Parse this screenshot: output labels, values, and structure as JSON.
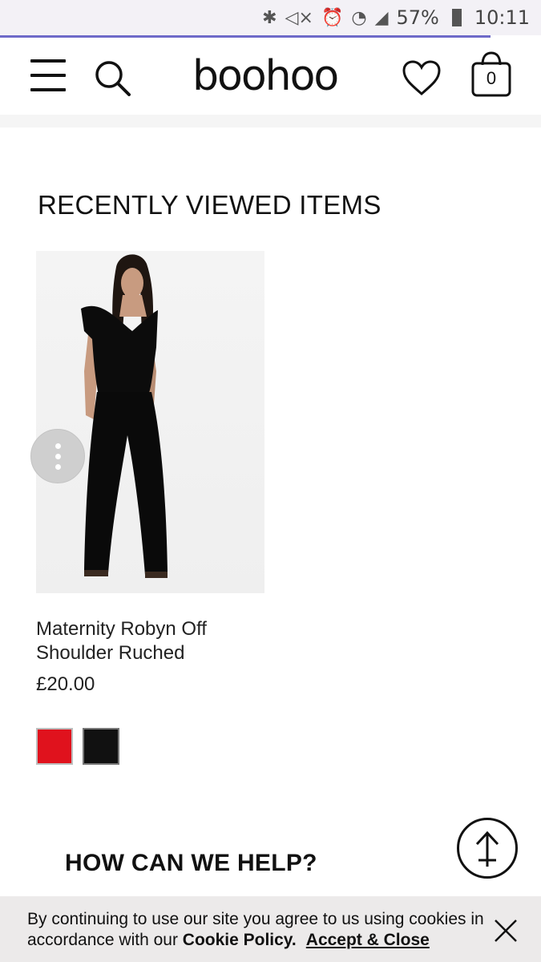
{
  "status_bar": {
    "battery": "57%",
    "time": "10:11",
    "icons": [
      "bluetooth-icon",
      "mute-icon",
      "alarm-icon",
      "wifi-icon",
      "signal-icon"
    ]
  },
  "header": {
    "logo": "boohoo",
    "bag_count": "0",
    "icons": [
      "menu-icon",
      "search-icon",
      "heart-icon",
      "bag-icon"
    ]
  },
  "recently_viewed": {
    "title": "RECENTLY VIEWED ITEMS",
    "product": {
      "name": "Maternity Robyn Off Shoulder Ruched",
      "price": "£20.00",
      "swatches": [
        {
          "color": "#e0121d"
        },
        {
          "color": "#111111"
        }
      ]
    }
  },
  "help": {
    "title": "HOW CAN WE HELP?"
  },
  "cookie": {
    "text_before": "By continuing to use our site you agree to us using cookies in accordance with our ",
    "policy_link": "Cookie Policy.",
    "accept_link": "Accept & Close"
  },
  "colors": {
    "accent": "#6e6ac9",
    "background": "#ffffff",
    "cookie_bg": "#eceaea"
  }
}
